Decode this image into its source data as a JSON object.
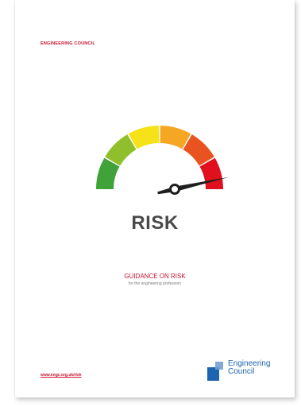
{
  "header": {
    "organisation": "ENGINEERING COUNCIL"
  },
  "cover": {
    "title": "RISK",
    "guidance": "GUIDANCE ON RISK",
    "subtitle": "for the engineering profession"
  },
  "gauge": {
    "segments": [
      "#3fa33a",
      "#8fbf2a",
      "#f6e218",
      "#f5a623",
      "#e9531f",
      "#e0101e"
    ],
    "needle_level": 0.93,
    "needle_color": "#1e1e1e"
  },
  "footer": {
    "url": "www.engc.org.uk/risk",
    "logo_line1": "Engineering",
    "logo_line2": "Council",
    "logo_color": "#1d63b0"
  }
}
